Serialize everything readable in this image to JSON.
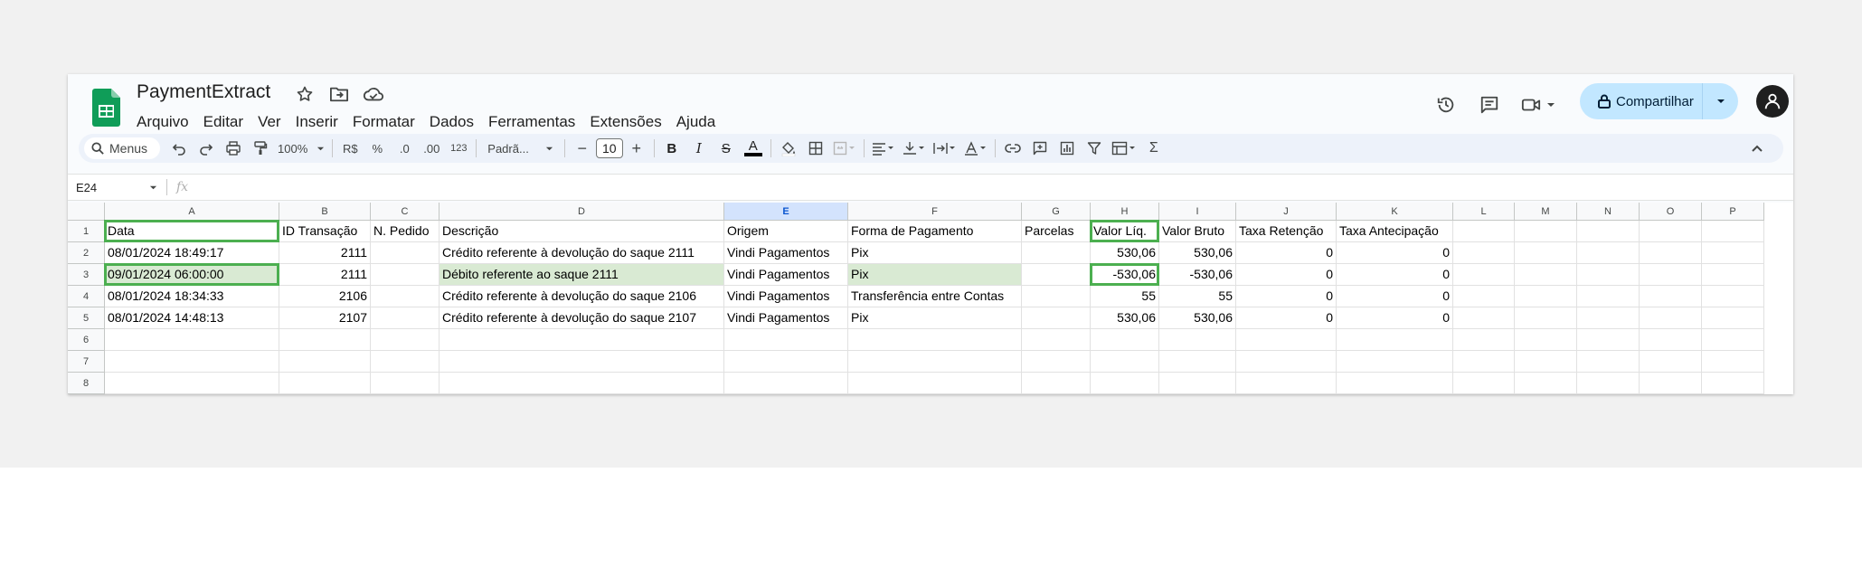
{
  "app": {
    "doc_title": "PaymentExtract",
    "menu": [
      "Arquivo",
      "Editar",
      "Ver",
      "Inserir",
      "Formatar",
      "Dados",
      "Ferramentas",
      "Extensões",
      "Ajuda"
    ],
    "share_label": "Compartilhar"
  },
  "toolbar": {
    "menus_label": "Menus",
    "zoom": "100%",
    "currency": "R$",
    "percent": "%",
    "dec_decrease": ".0",
    "dec_increase": ".00",
    "format_123": "123",
    "font": "Padrã...",
    "font_size": "10",
    "bold": "B",
    "italic": "I",
    "strike": "S",
    "text_color": "A",
    "sum": "Σ"
  },
  "formula_bar": {
    "cell_ref": "E24",
    "fx": "fx",
    "value": ""
  },
  "sheet": {
    "columns": [
      "A",
      "B",
      "C",
      "D",
      "E",
      "F",
      "G",
      "H",
      "I",
      "J",
      "K",
      "L",
      "M",
      "N",
      "O",
      "P"
    ],
    "rows": [
      "1",
      "2",
      "3",
      "4",
      "5",
      "6",
      "7",
      "8"
    ],
    "header_row": [
      "Data",
      "ID Transação",
      "N. Pedido",
      "Descrição",
      "Origem",
      "Forma de Pagamento",
      "Parcelas",
      "Valor Líq.",
      "Valor Bruto",
      "Taxa Retenção",
      "Taxa Antecipação"
    ],
    "data_rows": [
      [
        "08/01/2024 18:49:17",
        "2111",
        "",
        "Crédito referente à devolução do saque 2111",
        "Vindi Pagamentos",
        "Pix",
        "",
        "530,06",
        "530,06",
        "0",
        "0"
      ],
      [
        "09/01/2024 06:00:00",
        "2111",
        "",
        "Débito referente ao saque 2111",
        "Vindi Pagamentos",
        "Pix",
        "",
        "-530,06",
        "-530,06",
        "0",
        "0"
      ],
      [
        "08/01/2024 18:34:33",
        "2106",
        "",
        "Crédito referente à devolução do saque 2106",
        "Vindi Pagamentos",
        "Transferência entre Contas",
        "",
        "55",
        "55",
        "0",
        "0"
      ],
      [
        "08/01/2024 14:48:13",
        "2107",
        "",
        "Crédito referente à devolução do saque 2107",
        "Vindi Pagamentos",
        "Pix",
        "",
        "530,06",
        "530,06",
        "0",
        "0"
      ]
    ]
  },
  "colors": {
    "accent_green": "#4caf50",
    "row_highlight": "#d9ead3",
    "share_bg": "#c2e7ff",
    "selected_col_header": "#d3e3fd"
  }
}
